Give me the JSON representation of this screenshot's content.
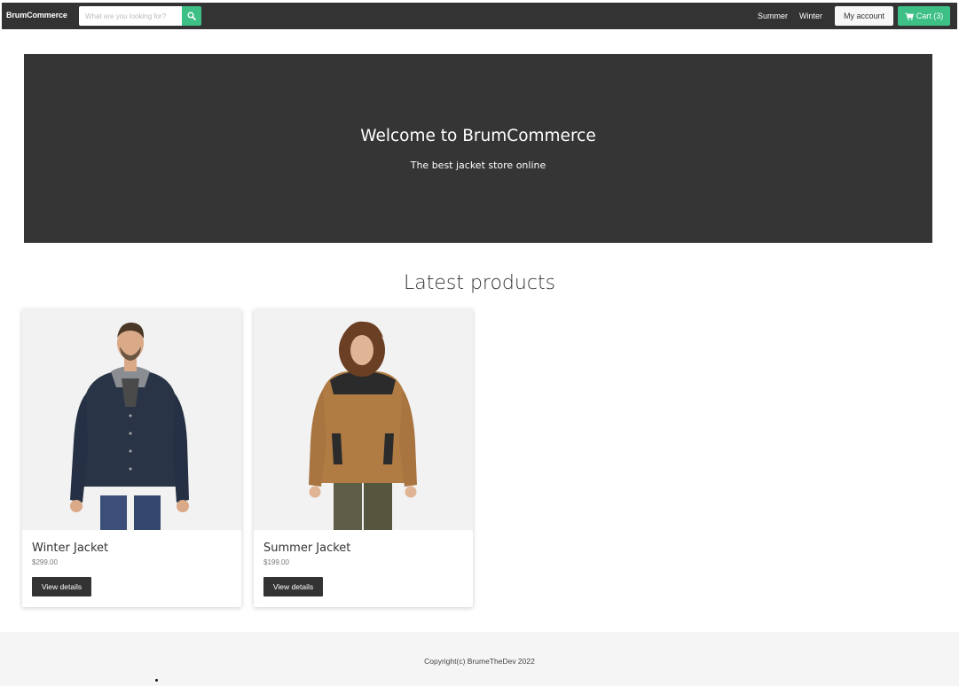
{
  "navbar": {
    "brand": "BrumCommerce",
    "search_placeholder": "What are you looking for?",
    "links": [
      "Summer",
      "Winter"
    ],
    "account_label": "My account",
    "cart_label": "Cart (3)",
    "icons": {
      "search": "search-icon",
      "cart": "cart-icon"
    },
    "colors": {
      "bar": "#333333",
      "accent": "#3dbf86"
    }
  },
  "hero": {
    "title": "Welcome to BrumCommerce",
    "subtitle": "The best jacket store online"
  },
  "products": {
    "heading": "Latest products",
    "items": [
      {
        "name": "Winter Jacket",
        "price": "$299.00",
        "button": "View details",
        "jacket_color": "#2a3447"
      },
      {
        "name": "Summer Jacket",
        "price": "$199.00",
        "button": "View details",
        "jacket_color": "#b07c44"
      }
    ]
  },
  "footer": {
    "copyright": "Copyright(c) BrumeTheDev 2022"
  }
}
